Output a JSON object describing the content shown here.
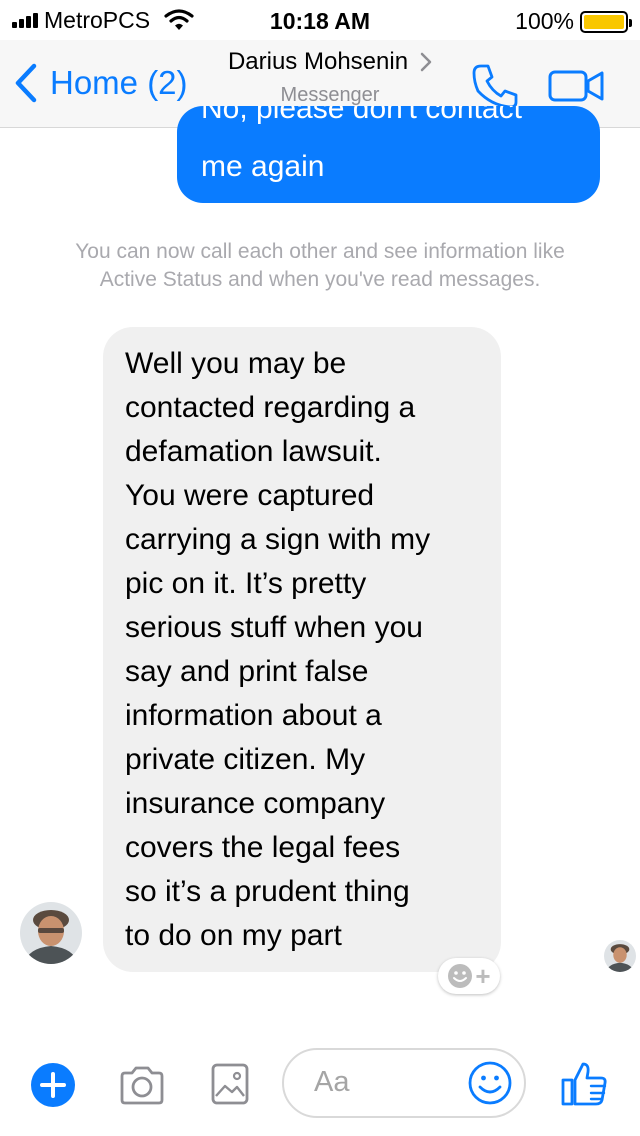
{
  "status_bar": {
    "carrier": "MetroPCS",
    "time": "10:18 AM",
    "battery": "100%"
  },
  "nav": {
    "back_label": "Home (2)",
    "contact_name": "Darius Mohsenin",
    "subtitle": "Messenger"
  },
  "messages": {
    "outgoing_cut_text": "No, please don't contact",
    "outgoing_text": "me again",
    "system_note": "You can now call each other and see information like\nActive Status and when you've read messages.",
    "incoming_text": "Well you may be\ncontacted regarding a\ndefamation lawsuit.\nYou were captured\ncarrying a sign with my\npic on it. It’s pretty\nserious stuff when you\nsay and print false\ninformation about a\nprivate citizen. My\ninsurance company\ncovers the legal fees\nso it’s a prudent thing\nto do on my part"
  },
  "composer": {
    "placeholder": "Aa"
  },
  "icons": {
    "back": "chevron-left-icon",
    "phone": "phone-icon",
    "video": "video-camera-icon",
    "add": "plus-icon",
    "camera": "camera-icon",
    "gallery": "image-icon",
    "emoji": "smiley-icon",
    "like": "thumbs-up-icon",
    "react": "add-reaction-icon"
  },
  "colors": {
    "accent": "#0a7cff",
    "outgoing_bubble": "#0a7cff",
    "incoming_bubble": "#f0f0f0",
    "system_text": "#a9a9ae",
    "battery_fill": "#f9c700"
  }
}
